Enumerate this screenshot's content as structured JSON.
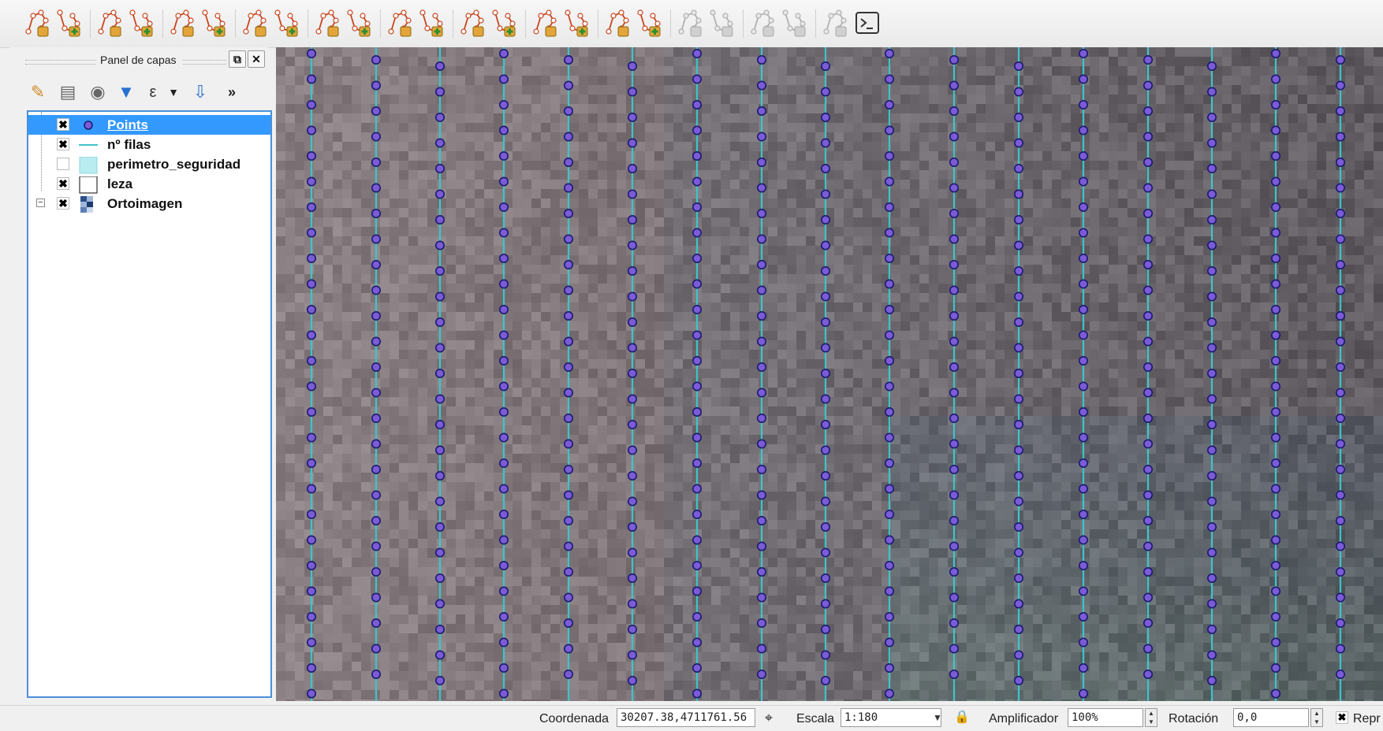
{
  "toolbar": {
    "icons": [
      "node-tool-icon",
      "add-node-icon",
      "split-features-icon",
      "add-line-icon",
      "reshape-icon",
      "offset-curve-icon",
      "simplify-icon",
      "split-line-icon",
      "delete-part-icon",
      "merge-features-icon",
      "rotate-point-icon",
      "label-tool-icon",
      "add-ring-icon",
      "fill-ring-icon",
      "move-feature-icon",
      "split-parts-icon",
      "delete-ring-icon",
      "add-part-icon",
      "disabled-digitize-icon-1",
      "disabled-digitize-icon-2",
      "disabled-digitize-icon-3",
      "disabled-digitize-icon-4",
      "disabled-digitize-icon-5",
      "python-console-icon"
    ]
  },
  "layers_panel": {
    "title": "Panel de capas",
    "tools": [
      "style-icon",
      "add-group-icon",
      "visibility-eye-icon",
      "filter-icon",
      "expression-filter-icon",
      "dropdown-icon",
      "expand-all-icon",
      "more-icon"
    ],
    "more_label": "»",
    "layers": [
      {
        "name": "Points",
        "checked": true,
        "selected": true,
        "symbol": "point"
      },
      {
        "name": "nº filas",
        "checked": true,
        "selected": false,
        "symbol": "line"
      },
      {
        "name": "perimetro_seguridad",
        "checked": false,
        "selected": false,
        "symbol": "polygon-cyan"
      },
      {
        "name": "leza",
        "checked": true,
        "selected": false,
        "symbol": "polygon-white"
      },
      {
        "name": "Ortoimagen",
        "checked": true,
        "selected": false,
        "symbol": "raster"
      }
    ],
    "checkmark": "✖"
  },
  "map": {
    "line_color": "#3ec4c9",
    "point_fill": "#7b5bd6",
    "point_stroke": "#1a1a6e"
  },
  "statusbar": {
    "coord_label": "Coordenada",
    "coord_value": "30207.38,4711761.56",
    "scale_label": "Escala",
    "scale_value": "1:180",
    "magnifier_label": "Amplificador",
    "magnifier_value": "100%",
    "rotation_label": "Rotación",
    "rotation_value": "0,0",
    "render_label": "Repr",
    "render_checked": "✖"
  }
}
